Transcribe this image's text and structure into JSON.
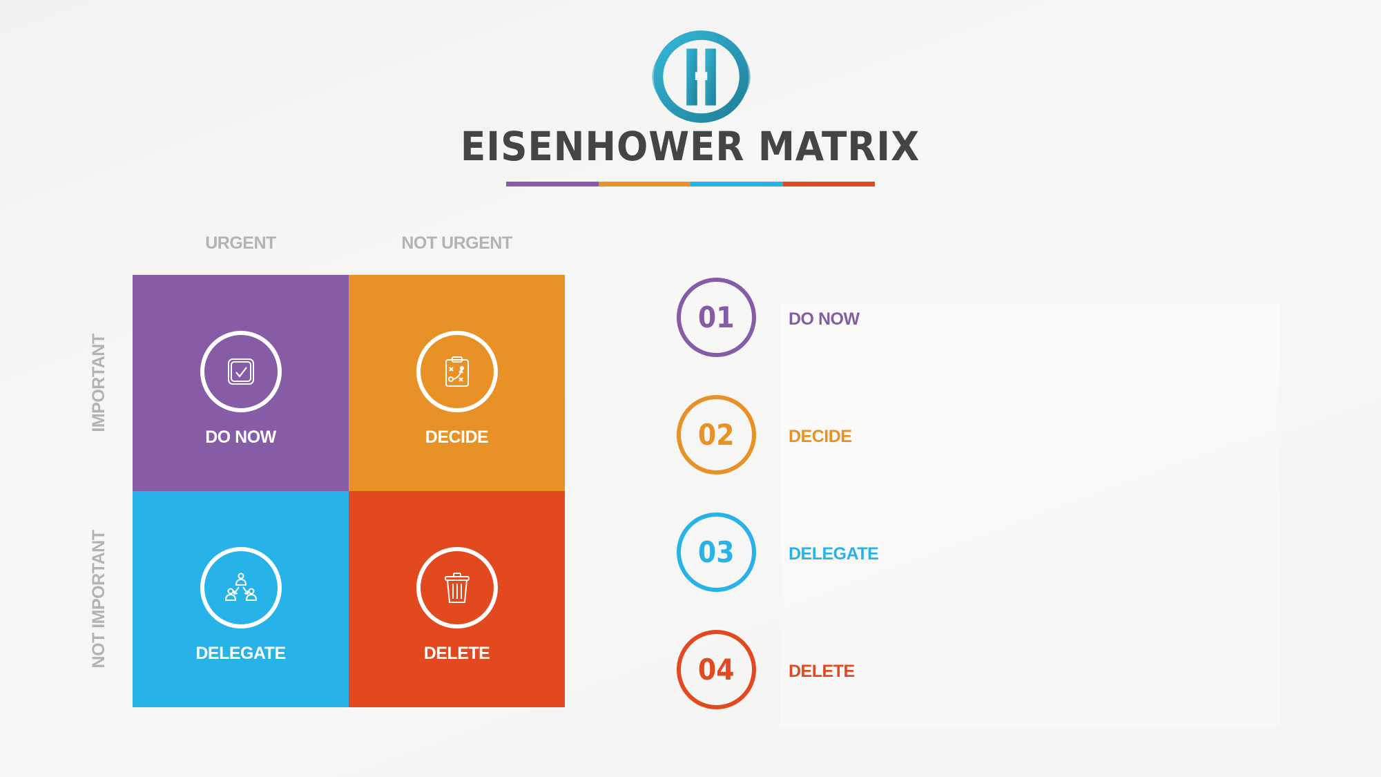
{
  "title": "EISENHOWER MATRIX",
  "logo": {
    "icon": "eisenhower-logo-icon",
    "color": "#2a9bb8"
  },
  "colors": {
    "purple": "#865ca6",
    "orange": "#e89127",
    "blue": "#27b2e8",
    "red": "#e3491e",
    "title": "#444444",
    "axis_label": "#b3b3b3"
  },
  "title_bar": [
    "#865ca6",
    "#e89127",
    "#27b2e8",
    "#e3491e"
  ],
  "columns": [
    "URGENT",
    "NOT URGENT"
  ],
  "rows": [
    "IMPORTANT",
    "NOT IMPORTANT"
  ],
  "quadrants": [
    {
      "label": "DO NOW",
      "icon": "checkbox-icon",
      "color": "#865ca6"
    },
    {
      "label": "DECIDE",
      "icon": "strategy-clipboard-icon",
      "color": "#e89127"
    },
    {
      "label": "DELEGATE",
      "icon": "delegate-people-icon",
      "color": "#27b2e8"
    },
    {
      "label": "DELETE",
      "icon": "trash-icon",
      "color": "#e3491e"
    }
  ],
  "list": [
    {
      "number": "01",
      "label": "DO NOW",
      "color": "#865ca6"
    },
    {
      "number": "02",
      "label": "DECIDE",
      "color": "#e89127"
    },
    {
      "number": "03",
      "label": "DELEGATE",
      "color": "#27b2e8"
    },
    {
      "number": "04",
      "label": "DELETE",
      "color": "#e3491e"
    }
  ]
}
